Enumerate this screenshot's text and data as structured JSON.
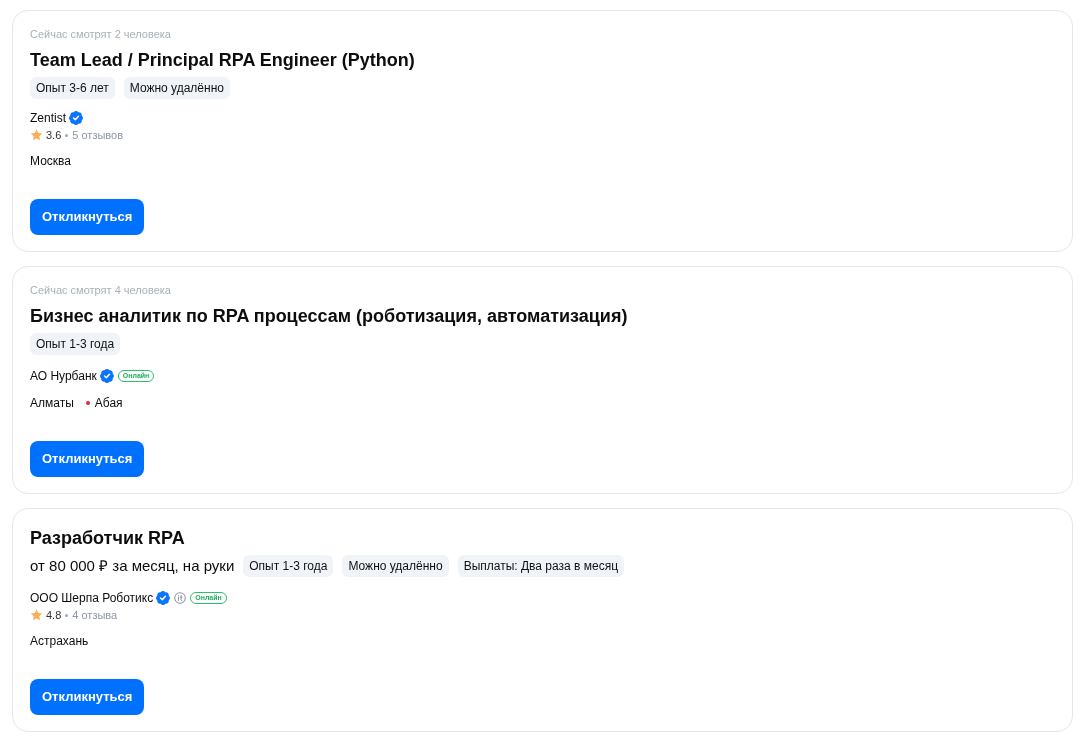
{
  "vacancies": [
    {
      "viewers": "Сейчас смотрят 2 человека",
      "title": "Team Lead / Principal RPA Engineer (Python)",
      "tags": [
        "Опыт 3-6 лет",
        "Можно удалённо"
      ],
      "company": {
        "name": "Zentist",
        "verified": true,
        "it_accredited": false
      },
      "rating": {
        "score": "3.6",
        "reviews": "5 отзывов"
      },
      "location": {
        "city": "Москва"
      },
      "button": "Откликнуться"
    },
    {
      "viewers": "Сейчас смотрят 4 человека",
      "title": "Бизнес аналитик по RPA процессам (роботизация, автоматизация)",
      "tags": [
        "Опыт 1-3 года"
      ],
      "company": {
        "name": "АО Нурбанк",
        "verified": true,
        "it_accredited": false,
        "status": "Онлайн"
      },
      "location": {
        "city": "Алматы",
        "metro": [
          {
            "name": "Абая",
            "color": "#e3262d"
          }
        ]
      },
      "button": "Откликнуться"
    },
    {
      "title": "Разработчик RPA",
      "salary": "от 80 000 ₽ за месяц, на руки",
      "tags": [
        "Опыт 1-3 года",
        "Можно удалённо",
        "Выплаты: Два раза в месяц"
      ],
      "company": {
        "name": "ООО Шерпа Роботикс",
        "verified": true,
        "it_accredited": true,
        "status": "Онлайн"
      },
      "rating": {
        "score": "4.8",
        "reviews": "4 отзыва"
      },
      "location": {
        "city": "Астрахань"
      },
      "button": "Откликнуться"
    }
  ]
}
